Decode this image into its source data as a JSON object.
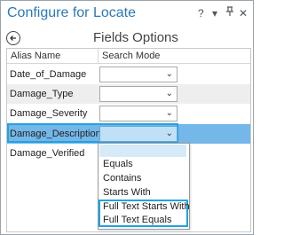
{
  "window": {
    "title": "Configure for Locate",
    "controls": {
      "help": "?",
      "menu": "▾",
      "pin": "ᵀ",
      "close": "✕"
    }
  },
  "panel": {
    "heading": "Fields Options"
  },
  "table": {
    "headers": {
      "alias": "Alias Name",
      "search": "Search Mode"
    },
    "rows": [
      {
        "alias": "Date_of_Damage",
        "value": ""
      },
      {
        "alias": "Damage_Type",
        "value": ""
      },
      {
        "alias": "Damage_Severity",
        "value": ""
      },
      {
        "alias": "Damage_Description",
        "value": ""
      },
      {
        "alias": "Damage_Verified",
        "value": ""
      }
    ],
    "selected_row": "Damage_Description"
  },
  "dropdown": {
    "options": [
      "",
      "Equals",
      "Contains",
      "Starts With",
      "Full Text Starts With",
      "Full Text Equals"
    ],
    "highlighted_options": [
      "Full Text Starts With",
      "Full Text Equals"
    ]
  },
  "colors": {
    "accent": "#2b79b6",
    "selection": "#74b7e9",
    "highlight_border": "#1fa3e0"
  }
}
